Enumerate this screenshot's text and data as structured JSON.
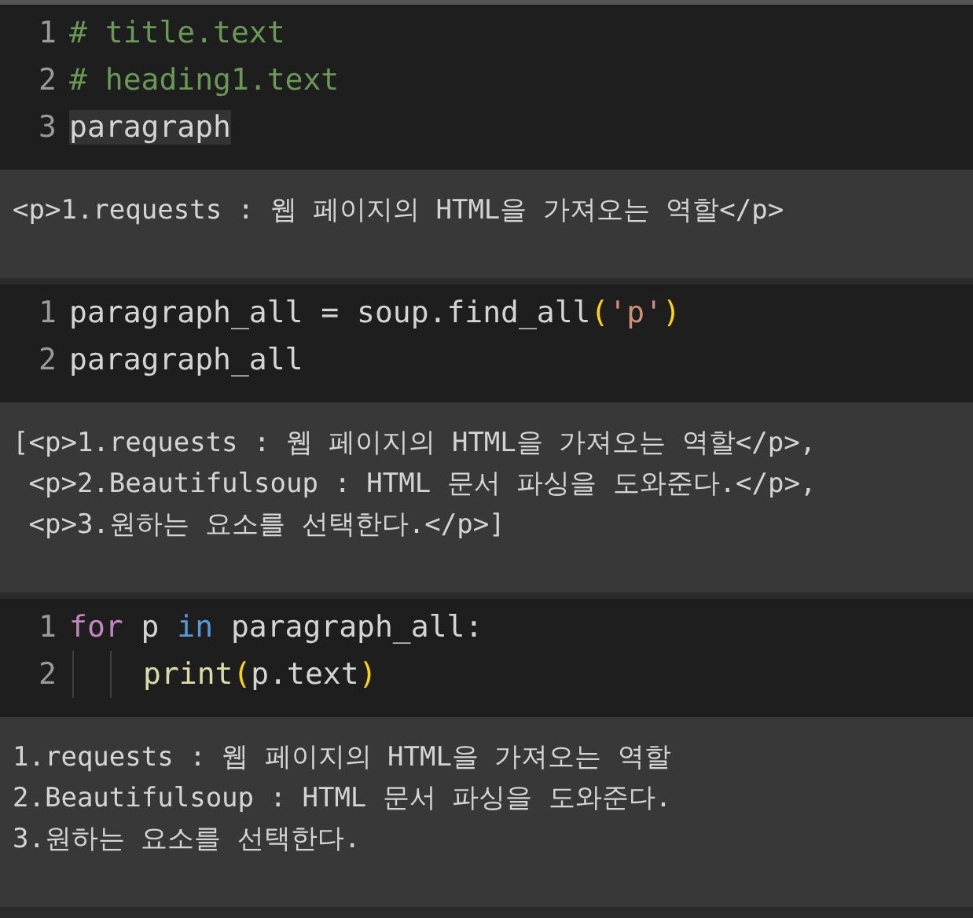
{
  "cells": [
    {
      "code": [
        {
          "number": "1",
          "tokens": [
            {
              "kind": "comment",
              "text": "# title.text"
            }
          ]
        },
        {
          "number": "2",
          "tokens": [
            {
              "kind": "comment",
              "text": "# heading1.text"
            }
          ]
        },
        {
          "number": "3",
          "tokens": [
            {
              "kind": "plain",
              "text": "paragraph",
              "highlighted": true
            }
          ]
        }
      ],
      "output": [
        "<p>1.requests : 웹 페이지의 HTML을 가져오는 역할</p>"
      ]
    },
    {
      "code": [
        {
          "number": "1",
          "tokens": [
            {
              "kind": "plain",
              "text": "paragraph_all = soup.find_all"
            },
            {
              "kind": "bracket",
              "text": "("
            },
            {
              "kind": "string",
              "text": "'p'"
            },
            {
              "kind": "bracket",
              "text": ")"
            }
          ]
        },
        {
          "number": "2",
          "tokens": [
            {
              "kind": "plain",
              "text": "paragraph_all"
            }
          ]
        }
      ],
      "output": [
        "[<p>1.requests : 웹 페이지의 HTML을 가져오는 역할</p>,",
        " <p>2.Beautifulsoup : HTML 문서 파싱을 도와준다.</p>,",
        " <p>3.원하는 요소를 선택한다.</p>]"
      ]
    },
    {
      "code": [
        {
          "number": "1",
          "tokens": [
            {
              "kind": "keyword",
              "text": "for"
            },
            {
              "kind": "plain",
              "text": " p "
            },
            {
              "kind": "operator",
              "text": "in"
            },
            {
              "kind": "plain",
              "text": " paragraph_all:"
            }
          ]
        },
        {
          "number": "2",
          "indented": true,
          "tokens": [
            {
              "kind": "function",
              "text": "print"
            },
            {
              "kind": "bracket",
              "text": "("
            },
            {
              "kind": "plain",
              "text": "p.text"
            },
            {
              "kind": "bracket",
              "text": ")"
            }
          ]
        }
      ],
      "output": [
        "1.requests : 웹 페이지의 HTML을 가져오는 역할",
        "2.Beautifulsoup : HTML 문서 파싱을 도와준다.",
        "3.원하는 요소를 선택한다."
      ]
    }
  ]
}
